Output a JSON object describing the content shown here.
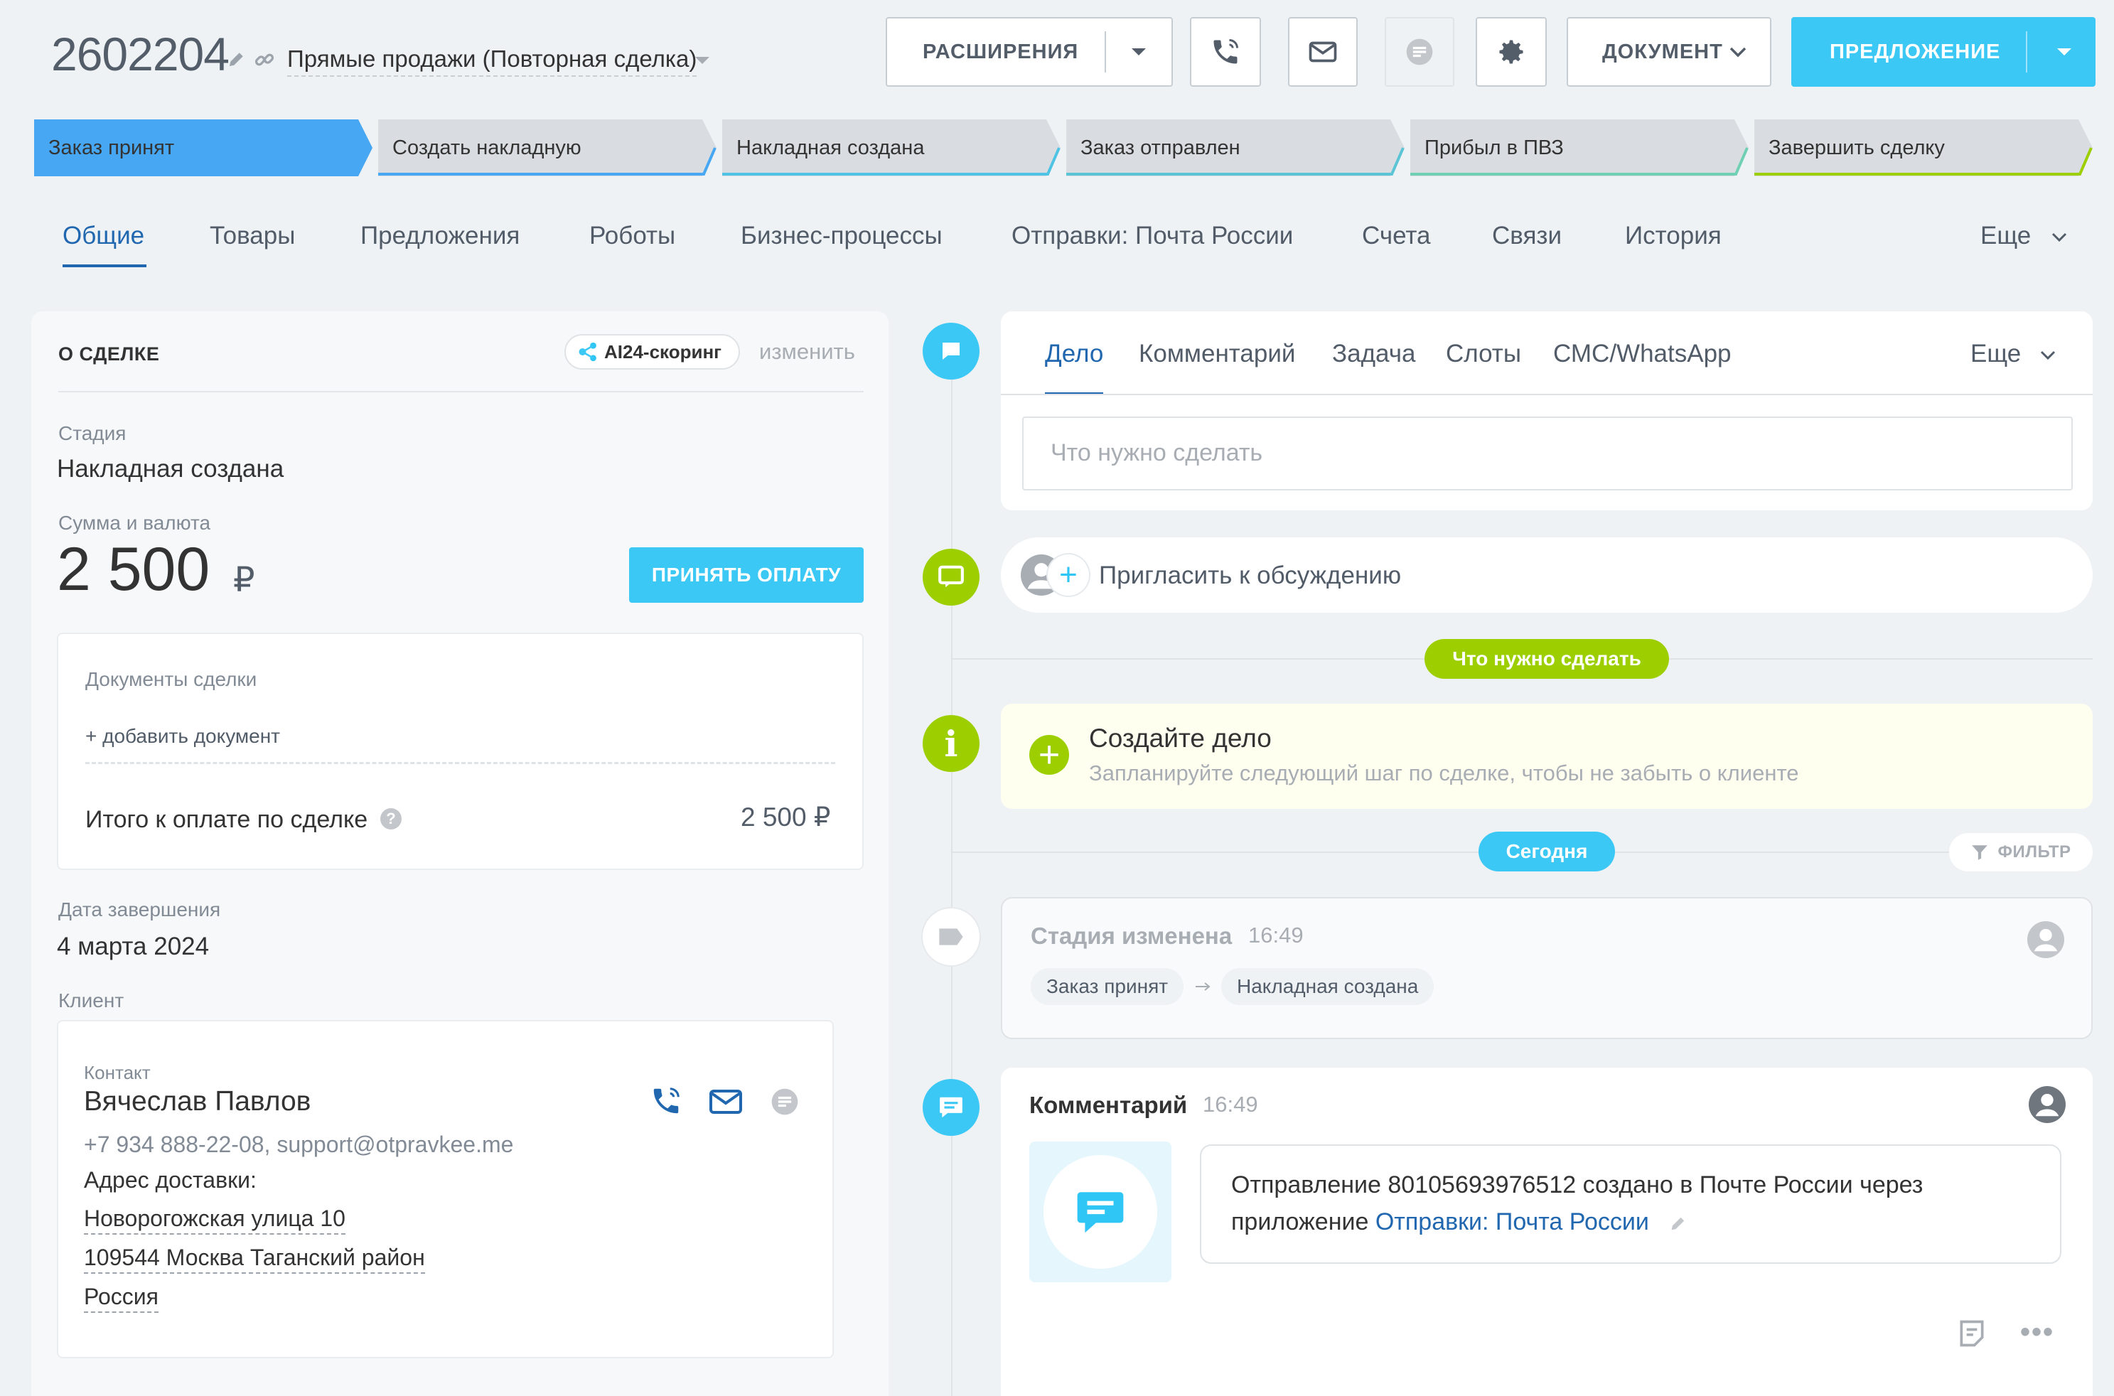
{
  "header": {
    "deal_id": "2602204",
    "category": "Прямые продажи (Повторная сделка)",
    "extensions_label": "РАСШИРЕНИЯ",
    "document_label": "ДОКУМЕНТ",
    "offer_label": "ПРЕДЛОЖЕНИЕ"
  },
  "stages": [
    {
      "label": "Заказ принят"
    },
    {
      "label": "Создать накладную"
    },
    {
      "label": "Накладная создана"
    },
    {
      "label": "Заказ отправлен"
    },
    {
      "label": "Прибыл в ПВЗ"
    },
    {
      "label": "Завершить сделку"
    }
  ],
  "tabs": [
    {
      "label": "Общие"
    },
    {
      "label": "Товары"
    },
    {
      "label": "Предложения"
    },
    {
      "label": "Роботы"
    },
    {
      "label": "Бизнес-процессы"
    },
    {
      "label": "Отправки: Почта России"
    },
    {
      "label": "Счета"
    },
    {
      "label": "Связи"
    },
    {
      "label": "История"
    },
    {
      "label": "Еще"
    }
  ],
  "deal": {
    "section_title": "О СДЕЛКЕ",
    "ai_scoring": "AI24-скоринг",
    "change_link": "изменить",
    "stage_label": "Стадия",
    "stage_value": "Накладная создана",
    "amount_label": "Сумма и валюта",
    "amount_value": "2 500",
    "currency": "₽",
    "accept_payment": "ПРИНЯТЬ ОПЛАТУ",
    "documents_label": "Документы сделки",
    "add_document": "+ добавить документ",
    "total_label": "Итого к оплате по сделке",
    "total_value": "2 500 ₽",
    "close_date_label": "Дата завершения",
    "close_date_value": "4 марта 2024",
    "client_label": "Клиент",
    "contact_label": "Контакт",
    "contact_name": "Вячеслав Павлов",
    "contact_info": "+7 934 888-22-08, support@otpravkee.me",
    "address_label": "Адрес доставки:",
    "address_lines": [
      "Новорогожская улица 10",
      "109544 Москва Таганский район",
      "Россия"
    ]
  },
  "timeline": {
    "new_tabs": [
      {
        "label": "Дело"
      },
      {
        "label": "Комментарий"
      },
      {
        "label": "Задача"
      },
      {
        "label": "Слоты"
      },
      {
        "label": "СМС/WhatsApp"
      },
      {
        "label": "Еще"
      }
    ],
    "todo_placeholder": "Что нужно сделать",
    "invite_text": "Пригласить к обсуждению",
    "todo_pill": "Что нужно сделать",
    "create_title": "Создайте дело",
    "create_subtitle": "Запланируйте следующий шаг по сделке, чтобы не забыть о клиенте",
    "today_pill": "Сегодня",
    "filter_label": "ФИЛЬТР",
    "stage_changed_title": "Стадия изменена",
    "stage_changed_time": "16:49",
    "stage_from": "Заказ принят",
    "stage_to": "Накладная создана",
    "comment_title": "Комментарий",
    "comment_time": "16:49",
    "comment_text": "Отправление 80105693976512 создано в Почте России через",
    "comment_text2": "приложение",
    "comment_link": "Отправки: Почта России"
  }
}
